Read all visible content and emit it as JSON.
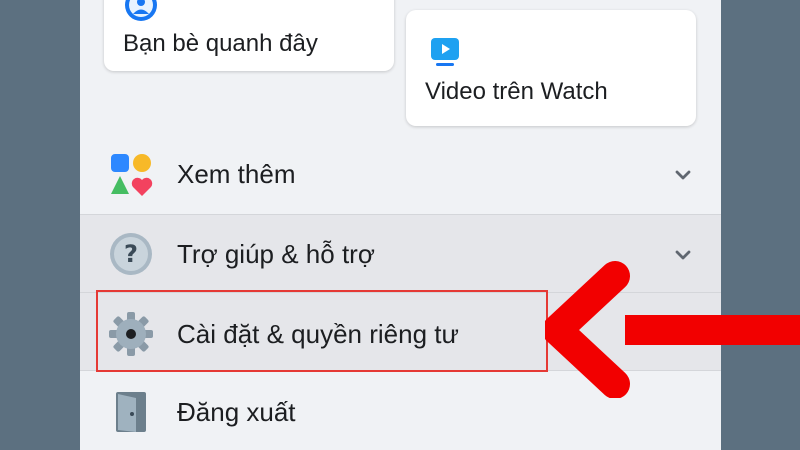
{
  "shortcuts": {
    "friends_nearby": {
      "label": "Bạn bè quanh đây",
      "icon": "friends-nearby-icon"
    },
    "watch_videos": {
      "label": "Video trên Watch",
      "icon": "watch-icon"
    }
  },
  "menu": {
    "items": [
      {
        "label": "Xem thêm",
        "icon": "see-more-icon",
        "expandable": true
      },
      {
        "label": "Trợ giúp & hỗ trợ",
        "icon": "help-icon",
        "expandable": true
      },
      {
        "label": "Cài đặt & quyền riêng tư",
        "icon": "gear-icon",
        "expandable": false,
        "highlighted": true
      },
      {
        "label": "Đăng xuất",
        "icon": "logout-door-icon",
        "expandable": false
      }
    ]
  },
  "annotation": {
    "highlight_color": "#e53935",
    "arrow_color": "#f20000",
    "points_to": "Cài đặt & quyền riêng tư"
  },
  "colors": {
    "screen_background": "#f0f2f5",
    "outside_background": "#5c7080",
    "accent_blue": "#1877f2"
  }
}
